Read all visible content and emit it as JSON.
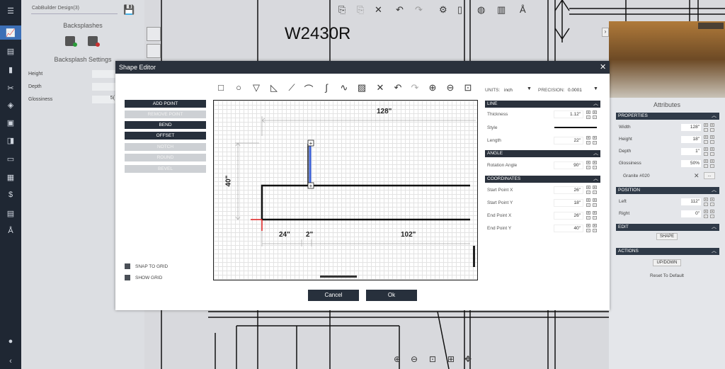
{
  "left_panel": {
    "design_name": "CabBuilder Design(3)",
    "backsplashes_title": "Backsplashes",
    "settings_title": "Backsplash Settings",
    "rows": [
      {
        "label": "Height",
        "value": ""
      },
      {
        "label": "Depth",
        "value": ""
      },
      {
        "label": "Glossiness",
        "value": "5("
      }
    ]
  },
  "canvas": {
    "big_label": "W2430R"
  },
  "modal": {
    "title": "Shape Editor",
    "side_buttons": [
      {
        "label": "ADD POINT",
        "enabled": true
      },
      {
        "label": "REMOVE POINT",
        "enabled": false
      },
      {
        "label": "BEND",
        "enabled": true
      },
      {
        "label": "OFFSET",
        "enabled": true
      },
      {
        "label": "NOTCH",
        "enabled": false
      },
      {
        "label": "ROUND",
        "enabled": false
      },
      {
        "label": "BEVEL",
        "enabled": false
      }
    ],
    "snap_to_grid": "SNAP TO GRID",
    "show_grid": "SHOW GRID",
    "dims": {
      "top": "128\"",
      "left": "40\"",
      "bottom_a": "24\"",
      "bottom_b": "2\"",
      "bottom_c": "102\""
    },
    "units_label": "UNITS:",
    "units_value": "inch",
    "precision_label": "PRECISION:",
    "precision_value": "0.0001",
    "line_section": "LINE",
    "thickness_label": "Thickness",
    "thickness_value": "1.12\"",
    "style_label": "Style",
    "length_label": "Length",
    "length_value": "22\"",
    "angle_section": "ANGLE",
    "rotation_label": "Rotation Angle",
    "rotation_value": "90°",
    "coords_section": "COORDINATES",
    "coords": [
      {
        "label": "Start Point X",
        "value": "26\""
      },
      {
        "label": "Start Point Y",
        "value": "18\""
      },
      {
        "label": "End Point X",
        "value": "26\""
      },
      {
        "label": "End Point Y",
        "value": "40\""
      }
    ],
    "cancel": "Cancel",
    "ok": "Ok"
  },
  "attributes": {
    "title": "Attributes",
    "properties": "PROPERTIES",
    "props": [
      {
        "label": "Width",
        "value": "128\""
      },
      {
        "label": "Height",
        "value": "18\""
      },
      {
        "label": "Depth",
        "value": "1\""
      },
      {
        "label": "Glossiness",
        "value": "50%"
      }
    ],
    "material": "Granite #020",
    "position": "POSITION",
    "pos": [
      {
        "label": "Left",
        "value": "112\""
      },
      {
        "label": "Right",
        "value": "0\""
      }
    ],
    "edit": "EDIT",
    "shape_btn": "SHAPE",
    "actions": "ACTIONS",
    "updown_btn": "UP/DOWN",
    "reset": "Reset To Default"
  }
}
